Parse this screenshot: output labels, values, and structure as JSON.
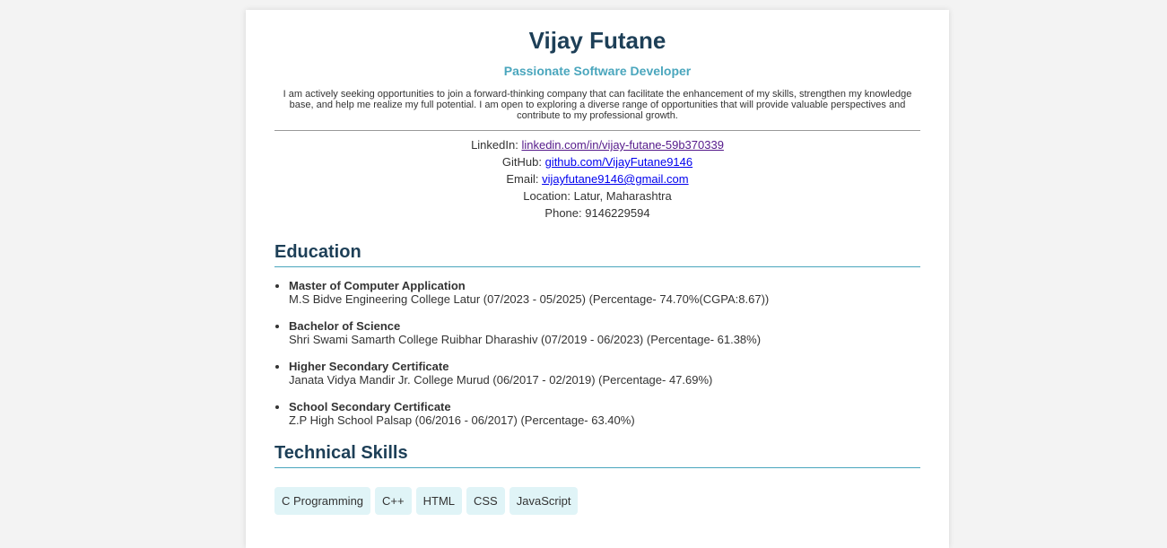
{
  "header": {
    "name": "Vijay Futane",
    "tagline": "Passionate Software Developer",
    "summary": "I am actively seeking opportunities to join a forward-thinking company that can facilitate the enhancement of my skills, strengthen my knowledge base, and help me realize my full potential. I am open to exploring a diverse range of opportunities that will provide valuable perspectives and contribute to my professional growth."
  },
  "contact": {
    "linkedin_label": "LinkedIn:",
    "linkedin_value": "linkedin.com/in/vijay-futane-59b370339",
    "github_label": "GitHub:",
    "github_value": "github.com/VijayFutane9146",
    "email_label": "Email:",
    "email_value": "vijayfutane9146@gmail.com",
    "location_label": "Location:",
    "location_value": "Latur, Maharashtra",
    "phone_label": "Phone:",
    "phone_value": "9146229594"
  },
  "education": {
    "title": "Education",
    "items": [
      {
        "degree": "Master of Computer Application",
        "details": "M.S Bidve Engineering College Latur (07/2023 - 05/2025) (Percentage- 74.70%(CGPA:8.67))"
      },
      {
        "degree": "Bachelor of Science",
        "details": "Shri Swami Samarth College Ruibhar Dharashiv (07/2019 - 06/2023) (Percentage- 61.38%)"
      },
      {
        "degree": "Higher Secondary Certificate",
        "details": "Janata Vidya Mandir Jr. College Murud (06/2017 - 02/2019) (Percentage- 47.69%)"
      },
      {
        "degree": "School Secondary Certificate",
        "details": "Z.P High School Palsap (06/2016 - 06/2017) (Percentage- 63.40%)"
      }
    ]
  },
  "skills": {
    "title": "Technical Skills",
    "items": [
      "C Programming",
      "C++",
      "HTML",
      "CSS",
      "JavaScript"
    ]
  },
  "colors": {
    "heading": "#1d3f57",
    "accent": "#4aa6bd",
    "skill_bg": "#e0f4f7",
    "visited_link": "#551a8b",
    "link": "#0000ee"
  }
}
